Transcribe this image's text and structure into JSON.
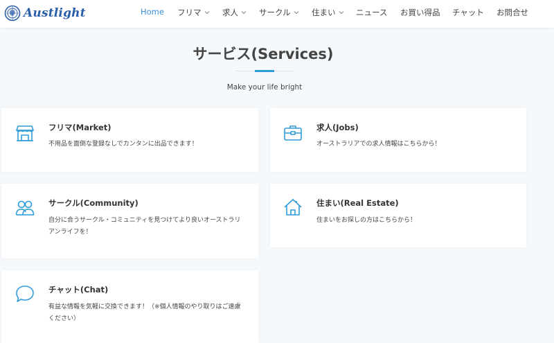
{
  "brand": {
    "name": "Austlight"
  },
  "nav": {
    "items": [
      {
        "label": "Home",
        "dropdown": false,
        "active": true
      },
      {
        "label": "フリマ",
        "dropdown": true,
        "active": false
      },
      {
        "label": "求人",
        "dropdown": true,
        "active": false
      },
      {
        "label": "サークル",
        "dropdown": true,
        "active": false
      },
      {
        "label": "住まい",
        "dropdown": true,
        "active": false
      },
      {
        "label": "ニュース",
        "dropdown": false,
        "active": false
      },
      {
        "label": "お買い得品",
        "dropdown": false,
        "active": false
      },
      {
        "label": "チャット",
        "dropdown": false,
        "active": false
      },
      {
        "label": "お問合せ",
        "dropdown": false,
        "active": false
      }
    ]
  },
  "section": {
    "title": "サービス(Services)",
    "subtitle": "Make your life bright"
  },
  "services": [
    {
      "icon": "store-icon",
      "title": "フリマ(Market)",
      "description": "不用品を面倒な登録なしでカンタンに出品できます！"
    },
    {
      "icon": "briefcase-icon",
      "title": "求人(Jobs)",
      "description": "オーストラリアでの求人情報はこちらから！"
    },
    {
      "icon": "users-icon",
      "title": "サークル(Community)",
      "description": "自分に合うサークル・コミュニティを見つけてより良いオーストラリアンライフを！"
    },
    {
      "icon": "home-icon",
      "title": "住まい(Real Estate)",
      "description": "住まいをお探しの方はこちらから！"
    },
    {
      "icon": "chat-icon",
      "title": "チャット(Chat)",
      "description": "有益な情報を気軽に交換できます！（※個人情報のやり取りはご遠慮ください）"
    }
  ],
  "colors": {
    "accent": "#2e9ad8",
    "nav_active": "#3a8fd6",
    "brand": "#2a5ea8",
    "background": "#f5f9fc"
  }
}
